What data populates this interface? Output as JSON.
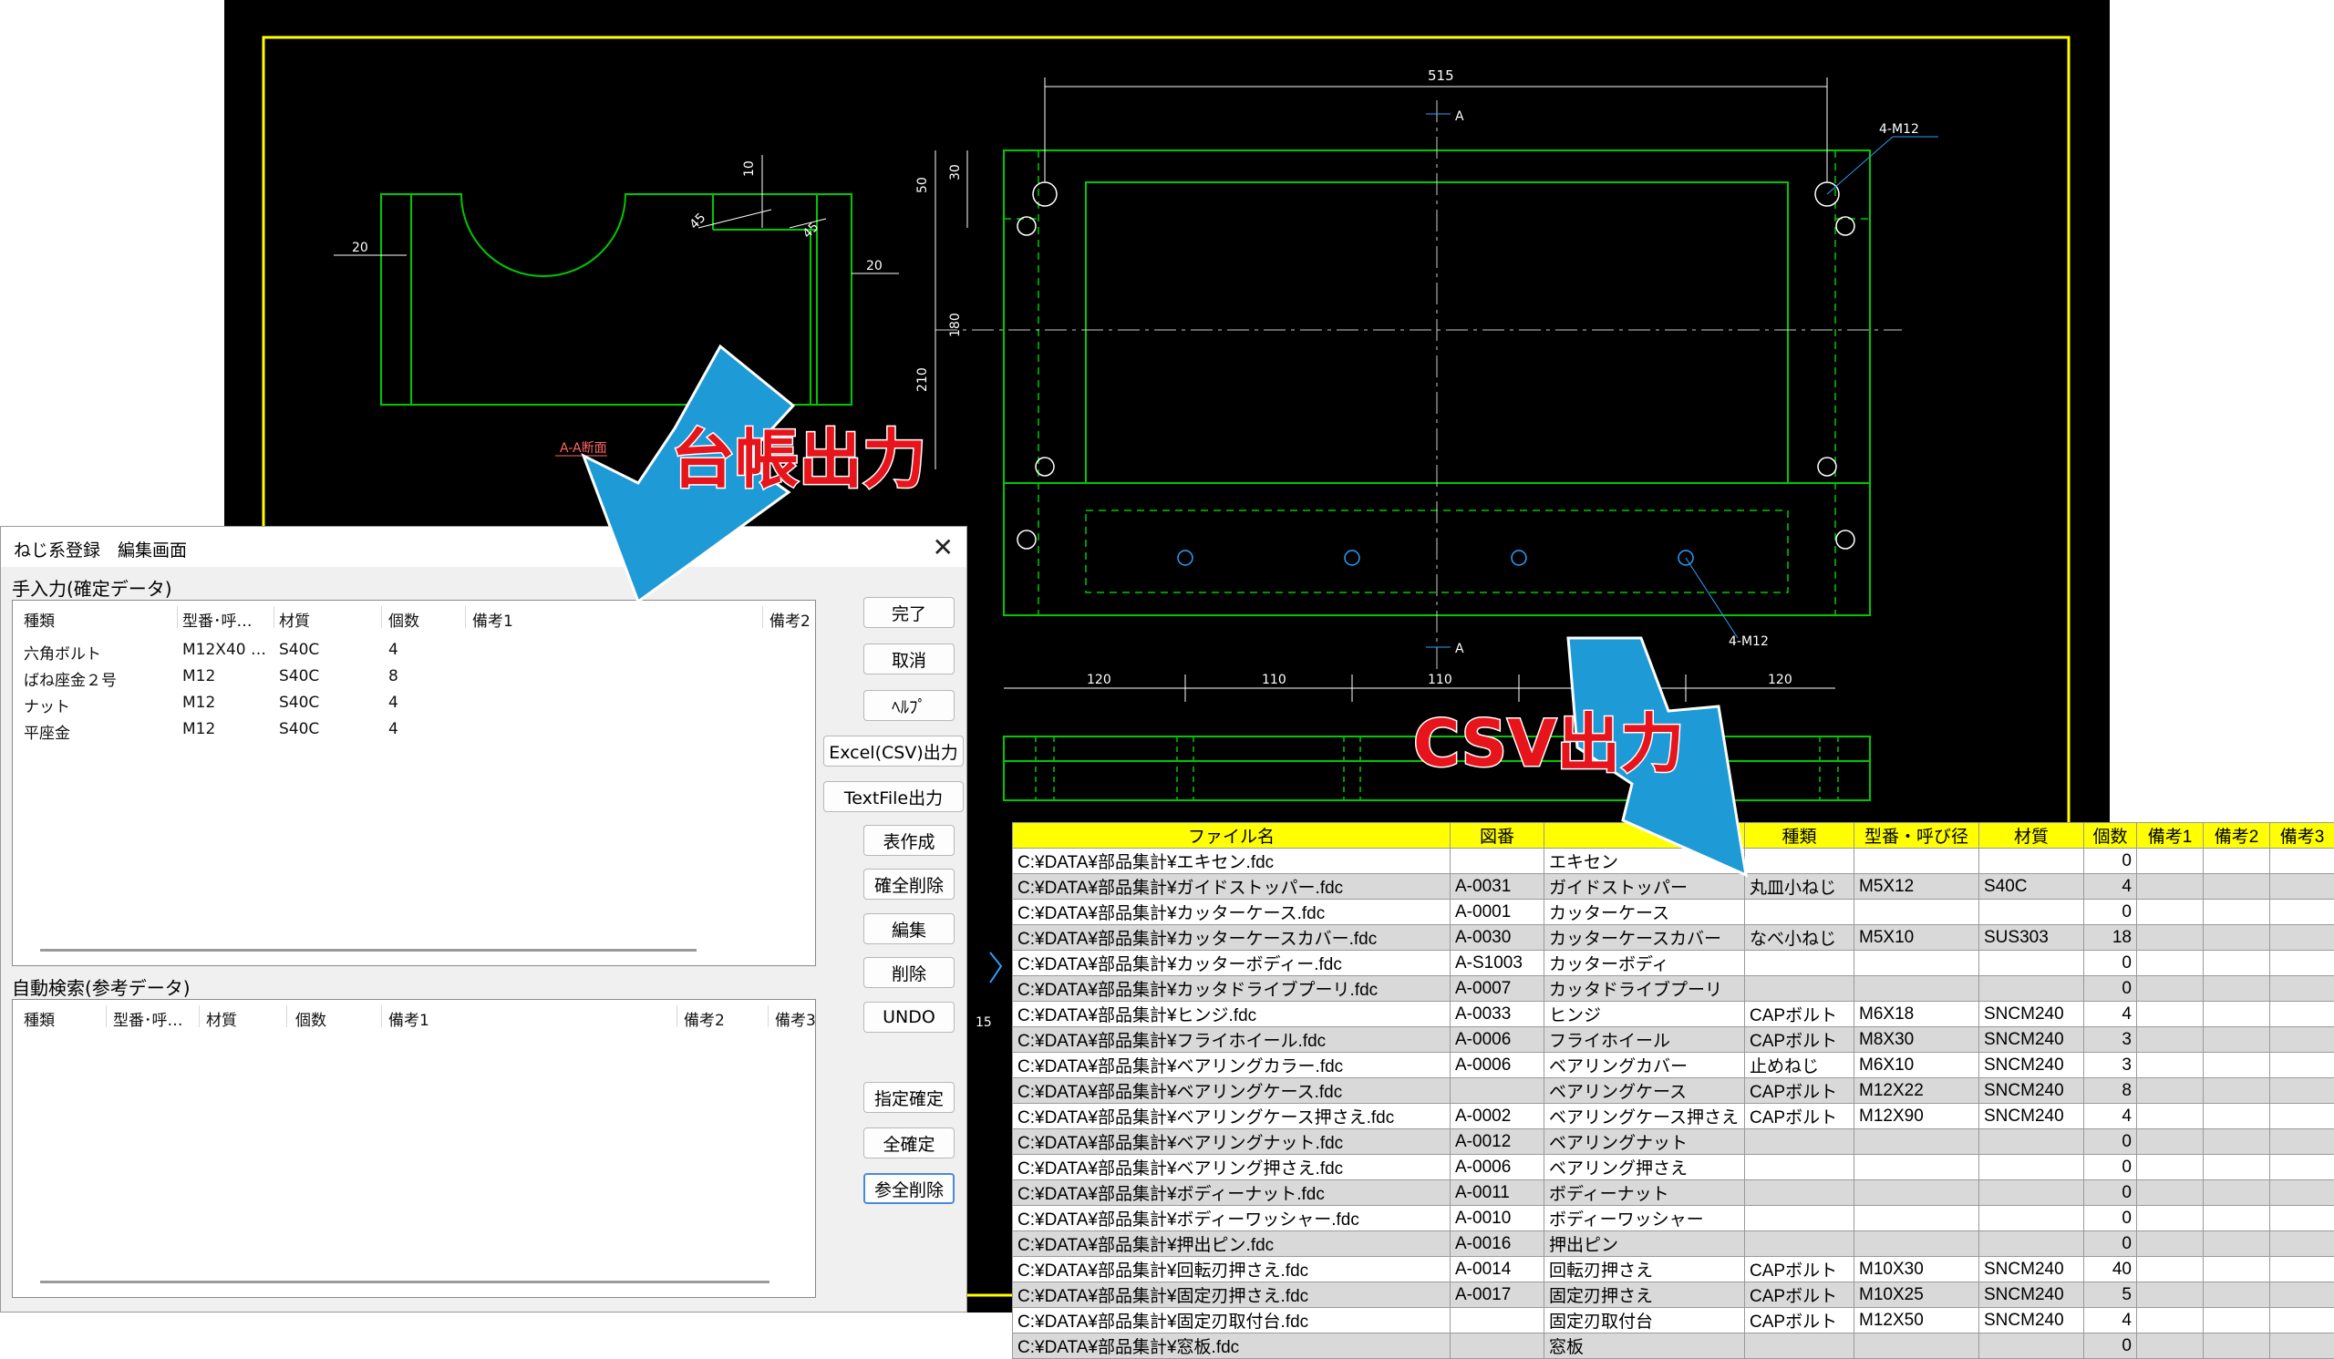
{
  "annotations": {
    "ledger_output": "台帳出力",
    "csv_output": "CSV出力"
  },
  "cad": {
    "dims": {
      "top_width": "515",
      "left_20a": "20",
      "left_20b": "20",
      "left_10": "10",
      "left_45a": "45",
      "left_45b": "45",
      "v_50": "50",
      "v_30": "30",
      "v_180": "180",
      "v_210": "210",
      "b_120a": "120",
      "b_110a": "110",
      "b_110b": "110",
      "b_120b": "120",
      "side_15": "15"
    },
    "labels": {
      "section_a_top": "A",
      "section_a_bottom": "A",
      "holes_top": "4-M12",
      "holes_bottom": "4-M12",
      "left_part": "A-A断面"
    }
  },
  "dialog": {
    "title": "ねじ系登録　編集画面",
    "manual_label": "手入力(確定データ)",
    "auto_label": "自動検索(参考データ)",
    "manual_columns": [
      "種類",
      "型番･呼…",
      "材質",
      "個数",
      "備考1",
      "備考2"
    ],
    "manual_rows": [
      {
        "kind": "六角ボルト",
        "model": "M12X40 …",
        "material": "S40C",
        "qty": "4"
      },
      {
        "kind": "ばね座金２号",
        "model": "M12",
        "material": "S40C",
        "qty": "8"
      },
      {
        "kind": "ナット",
        "model": "M12",
        "material": "S40C",
        "qty": "4"
      },
      {
        "kind": "平座金",
        "model": "M12",
        "material": "S40C",
        "qty": "4"
      }
    ],
    "auto_columns": [
      "種類",
      "型番･呼…",
      "材質",
      "個数",
      "備考1",
      "備考2",
      "備考3"
    ],
    "buttons": {
      "done": "完了",
      "cancel": "取消",
      "help": "ﾍﾙﾌﾟ",
      "excel_csv": "Excel(CSV)出力",
      "textfile": "TextFile出力",
      "make_table": "表作成",
      "confirm_delete_all": "確全削除",
      "edit": "編集",
      "delete": "削除",
      "undo": "UNDO",
      "specify_confirm": "指定確定",
      "confirm_all": "全確定",
      "ref_delete_all": "参全削除"
    }
  },
  "csv": {
    "headers": [
      "ファイル名",
      "図番",
      "",
      "種類",
      "型番・呼び径",
      "材質",
      "個数",
      "備考1",
      "備考2",
      "備考3"
    ],
    "rows": [
      [
        "C:¥DATA¥部品集計¥エキセン.fdc",
        "",
        "エキセン",
        "",
        "",
        "",
        "0",
        "",
        "",
        ""
      ],
      [
        "C:¥DATA¥部品集計¥ガイドストッパー.fdc",
        "A-0031",
        "ガイドストッパー",
        "丸皿小ねじ",
        "M5X12",
        "S40C",
        "4",
        "",
        "",
        ""
      ],
      [
        "C:¥DATA¥部品集計¥カッターケース.fdc",
        "A-0001",
        "カッターケース",
        "",
        "",
        "",
        "0",
        "",
        "",
        ""
      ],
      [
        "C:¥DATA¥部品集計¥カッターケースカバー.fdc",
        "A-0030",
        "カッターケースカバー",
        "なべ小ねじ",
        "M5X10",
        "SUS303",
        "18",
        "",
        "",
        ""
      ],
      [
        "C:¥DATA¥部品集計¥カッターボディー.fdc",
        "A-S1003",
        "カッターボディ",
        "",
        "",
        "",
        "0",
        "",
        "",
        ""
      ],
      [
        "C:¥DATA¥部品集計¥カッタドライブプーリ.fdc",
        "A-0007",
        "カッタドライブプーリ",
        "",
        "",
        "",
        "0",
        "",
        "",
        ""
      ],
      [
        "C:¥DATA¥部品集計¥ヒンジ.fdc",
        "A-0033",
        "ヒンジ",
        "CAPボルト",
        "M6X18",
        "SNCM240",
        "4",
        "",
        "",
        ""
      ],
      [
        "C:¥DATA¥部品集計¥フライホイール.fdc",
        "A-0006",
        "フライホイール",
        "CAPボルト",
        "M8X30",
        "SNCM240",
        "3",
        "",
        "",
        ""
      ],
      [
        "C:¥DATA¥部品集計¥ベアリングカラー.fdc",
        "A-0006",
        "ベアリングカバー",
        "止めねじ",
        "M6X10",
        "SNCM240",
        "3",
        "",
        "",
        ""
      ],
      [
        "C:¥DATA¥部品集計¥ベアリングケース.fdc",
        "",
        "ベアリングケース",
        "CAPボルト",
        "M12X22",
        "SNCM240",
        "8",
        "",
        "",
        ""
      ],
      [
        "C:¥DATA¥部品集計¥ベアリングケース押さえ.fdc",
        "A-0002",
        "ベアリングケース押さえ",
        "CAPボルト",
        "M12X90",
        "SNCM240",
        "4",
        "",
        "",
        ""
      ],
      [
        "C:¥DATA¥部品集計¥ベアリングナット.fdc",
        "A-0012",
        "ベアリングナット",
        "",
        "",
        "",
        "0",
        "",
        "",
        ""
      ],
      [
        "C:¥DATA¥部品集計¥ベアリング押さえ.fdc",
        "A-0006",
        "ベアリング押さえ",
        "",
        "",
        "",
        "0",
        "",
        "",
        ""
      ],
      [
        "C:¥DATA¥部品集計¥ボディーナット.fdc",
        "A-0011",
        "ボディーナット",
        "",
        "",
        "",
        "0",
        "",
        "",
        ""
      ],
      [
        "C:¥DATA¥部品集計¥ボディーワッシャー.fdc",
        "A-0010",
        "ボディーワッシャー",
        "",
        "",
        "",
        "0",
        "",
        "",
        ""
      ],
      [
        "C:¥DATA¥部品集計¥押出ピン.fdc",
        "A-0016",
        "押出ピン",
        "",
        "",
        "",
        "0",
        "",
        "",
        ""
      ],
      [
        "C:¥DATA¥部品集計¥回転刃押さえ.fdc",
        "A-0014",
        "回転刃押さえ",
        "CAPボルト",
        "M10X30",
        "SNCM240",
        "40",
        "",
        "",
        ""
      ],
      [
        "C:¥DATA¥部品集計¥固定刃押さえ.fdc",
        "A-0017",
        "固定刃押さえ",
        "CAPボルト",
        "M10X25",
        "SNCM240",
        "5",
        "",
        "",
        ""
      ],
      [
        "C:¥DATA¥部品集計¥固定刃取付台.fdc",
        "",
        "固定刃取付台",
        "CAPボルト",
        "M12X50",
        "SNCM240",
        "4",
        "",
        "",
        ""
      ],
      [
        "C:¥DATA¥部品集計¥窓板.fdc",
        "",
        "窓板",
        "",
        "",
        "",
        "0",
        "",
        "",
        ""
      ]
    ]
  },
  "colors": {
    "cad_bg": "#000000",
    "frame": "#ffff00",
    "part": "#00c800",
    "dim": "#ffffff",
    "hole": "#2aa0ff",
    "annotation_arrow": "#1e9ad6",
    "annotation_text": "#e8141b",
    "csv_header": "#ffff00"
  }
}
